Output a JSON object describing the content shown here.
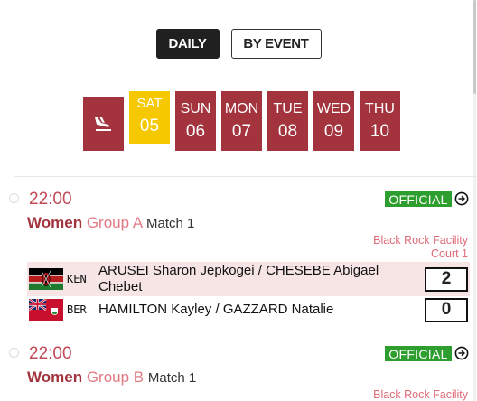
{
  "view_toggle": {
    "daily_label": "DAILY",
    "by_event_label": "BY EVENT"
  },
  "days": [
    {
      "name": "SAT",
      "num": "05",
      "selected": true
    },
    {
      "name": "SUN",
      "num": "06"
    },
    {
      "name": "MON",
      "num": "07"
    },
    {
      "name": "TUE",
      "num": "08"
    },
    {
      "name": "WED",
      "num": "09"
    },
    {
      "name": "THU",
      "num": "10"
    }
  ],
  "matches": [
    {
      "time": "22:00",
      "status": "OFFICIAL",
      "gender": "Women",
      "group": "Group A",
      "match": "Match 1",
      "venue_line1": "Black Rock Facility",
      "venue_line2": "Court 1",
      "teams": [
        {
          "code": "KEN",
          "names": "ARUSEI Sharon Jepkogei / CHESEBE Abigael Chebet",
          "score": "2"
        },
        {
          "code": "BER",
          "names": "HAMILTON Kayley / GAZZARD Natalie",
          "score": "0"
        }
      ]
    },
    {
      "time": "22:00",
      "status": "OFFICIAL",
      "gender": "Women",
      "group": "Group B",
      "match": "Match 1",
      "venue_line1": "Black Rock Facility"
    }
  ],
  "colors": {
    "accent": "#a3333d",
    "selected_day": "#f5c800",
    "official": "#2e9e2e"
  }
}
